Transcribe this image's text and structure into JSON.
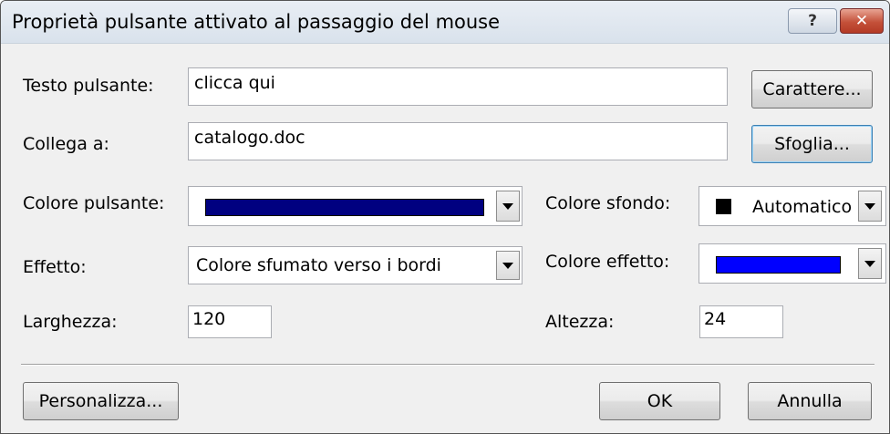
{
  "window": {
    "title": "Proprietà pulsante attivato al passaggio del mouse",
    "help_glyph": "?",
    "close_glyph": "✕"
  },
  "fields": {
    "button_text_label": "Testo pulsante:",
    "button_text_value": "clicca qui",
    "link_label": "Collega a:",
    "link_value": "catalogo.doc",
    "button_color_label": "Colore pulsante:",
    "background_color_label": "Colore sfondo:",
    "background_color_value": "Automatico",
    "effect_label": "Effetto:",
    "effect_value": "Colore sfumato verso i bordi",
    "effect_color_label": "Colore effetto:",
    "width_label": "Larghezza:",
    "width_value": "120",
    "height_label": "Altezza:",
    "height_value": "24"
  },
  "colors": {
    "button_color": "#000080",
    "background_color": "#000000",
    "effect_color": "#0000ff"
  },
  "buttons": {
    "font": "Carattere...",
    "browse": "Sfoglia...",
    "customize": "Personalizza...",
    "ok": "OK",
    "cancel": "Annulla"
  }
}
